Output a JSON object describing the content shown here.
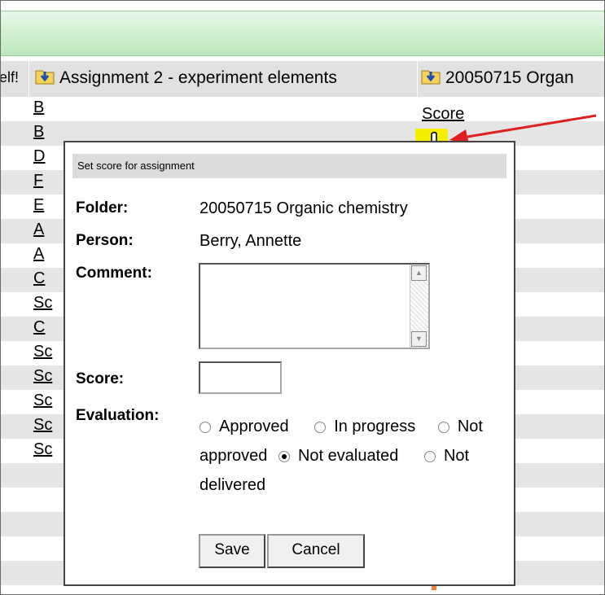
{
  "header": {
    "col_left_partial": "elf!",
    "col1": "Assignment 2 - experiment elements",
    "col2": "20050715 Organ"
  },
  "rows": [
    "B",
    "B",
    "D",
    "F",
    "E",
    "A",
    "A",
    "C",
    "Sc",
    "C",
    "Sc",
    "Sc",
    "Sc",
    "Sc",
    "Sc"
  ],
  "score_link": "Score",
  "dialog": {
    "title": "Set score for assignment",
    "folder_label": "Folder:",
    "folder_value": "20050715 Organic chemistry",
    "person_label": "Person:",
    "person_value": "Berry, Annette",
    "comment_label": "Comment:",
    "comment_value": "",
    "score_label": "Score:",
    "score_value": "",
    "evaluation_label": "Evaluation:",
    "evaluation_options": [
      "Approved",
      "In progress",
      "Not approved",
      "Not evaluated",
      "Not delivered"
    ],
    "evaluation_selected": "Not evaluated",
    "save_label": "Save",
    "cancel_label": "Cancel"
  },
  "colors": {
    "green_bar": "#bde7bd",
    "highlight": "#f6f000",
    "arrow": "#e02020"
  }
}
